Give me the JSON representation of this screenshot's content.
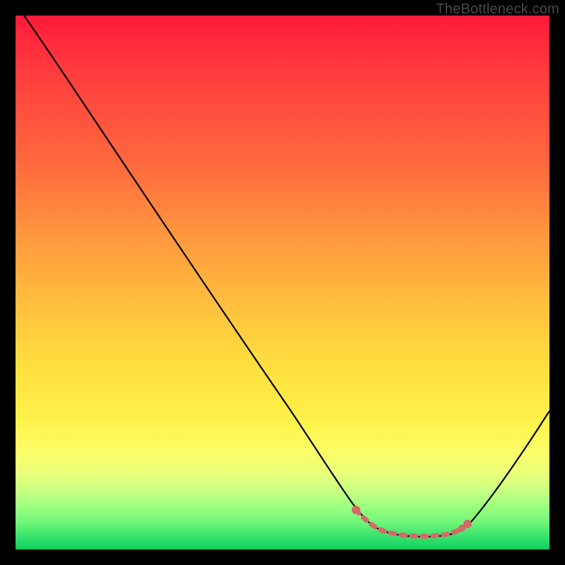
{
  "watermark": "TheBottleneck.com",
  "chart_data": {
    "type": "line",
    "title": "",
    "xlabel": "",
    "ylabel": "",
    "xlim": [
      0,
      100
    ],
    "ylim": [
      0,
      100
    ],
    "grid": false,
    "legend": false,
    "background": "rainbow-gradient-vertical-red-to-green",
    "series": [
      {
        "name": "bottleneck-curve",
        "color": "#000000",
        "x": [
          2,
          6,
          10,
          15,
          20,
          25,
          30,
          35,
          40,
          45,
          50,
          55,
          60,
          63,
          66,
          70,
          74,
          78,
          82,
          86,
          90,
          94,
          98,
          100
        ],
        "y": [
          100,
          96,
          92,
          86,
          78,
          71,
          63,
          55,
          47,
          39,
          31,
          23,
          16,
          11,
          7,
          4,
          3,
          3,
          3.5,
          5,
          9,
          15,
          22,
          26
        ]
      }
    ],
    "highlight": {
      "name": "optimal-range",
      "color": "#d46a6a",
      "style": "dotted",
      "x": [
        63,
        66,
        70,
        74,
        78,
        82,
        84
      ],
      "y": [
        8,
        5,
        4,
        3,
        3,
        3.5,
        4.5
      ],
      "endpoints": [
        [
          63,
          8
        ],
        [
          84,
          4.5
        ]
      ]
    }
  }
}
